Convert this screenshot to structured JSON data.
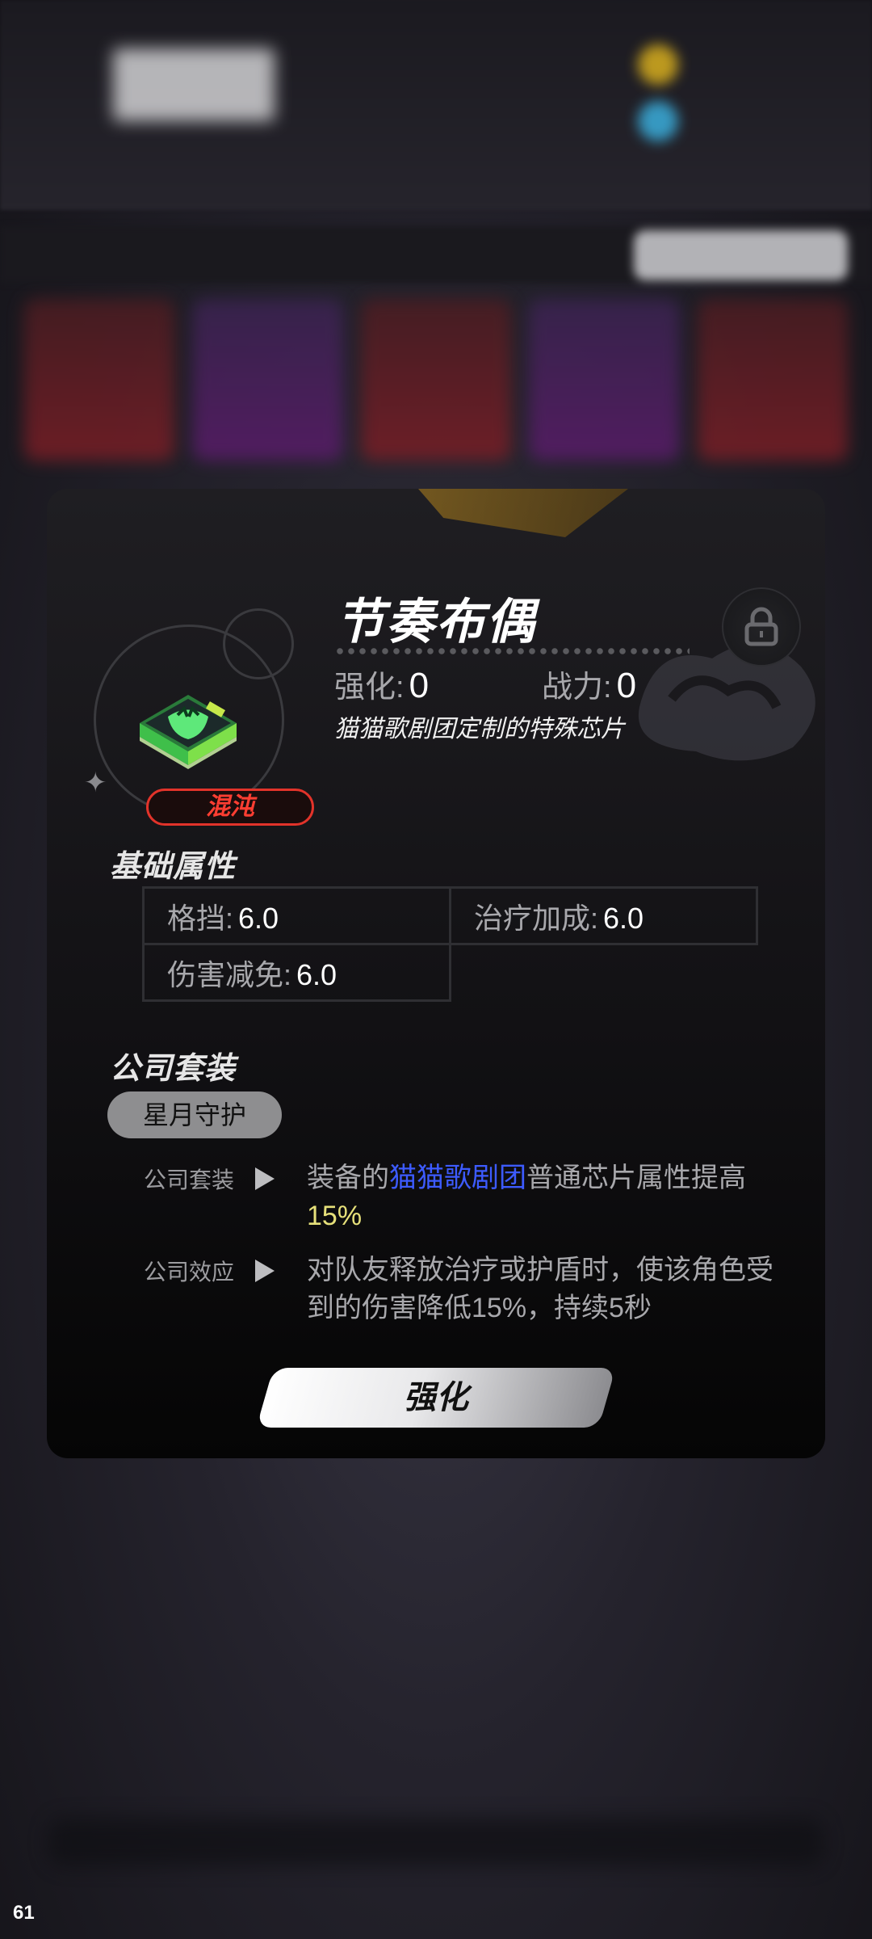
{
  "status": {
    "fps": "61"
  },
  "chip": {
    "name": "节奏布偶",
    "enhance_label": "强化:",
    "enhance_value": "0",
    "power_label": "战力:",
    "power_value": "0",
    "description": "猫猫歌剧团定制的特殊芯片",
    "rarity": "混沌",
    "rarity_color": "#e2332a",
    "icon": "chip-icon",
    "lock_icon": "lock-icon"
  },
  "basic": {
    "heading": "基础属性",
    "attributes": [
      {
        "label": "格挡:",
        "value": "6.0"
      },
      {
        "label": "治疗加成:",
        "value": "6.0"
      },
      {
        "label": "伤害减免:",
        "value": "6.0"
      }
    ]
  },
  "company": {
    "heading": "公司套装",
    "set_name": "星月守护",
    "rows": [
      {
        "label": "公司套装",
        "text_pre": "装备的",
        "text_highlight": "猫猫歌剧团",
        "text_mid": "普通芯片属性提高",
        "text_value": "15%"
      },
      {
        "label": "公司效应",
        "text": "对队友释放治疗或护盾时，使该角色受到的伤害降低15%，持续5秒"
      }
    ],
    "highlight_color": "#3d5bff",
    "value_color": "#e6e07a"
  },
  "actions": {
    "strengthen": "强化"
  }
}
